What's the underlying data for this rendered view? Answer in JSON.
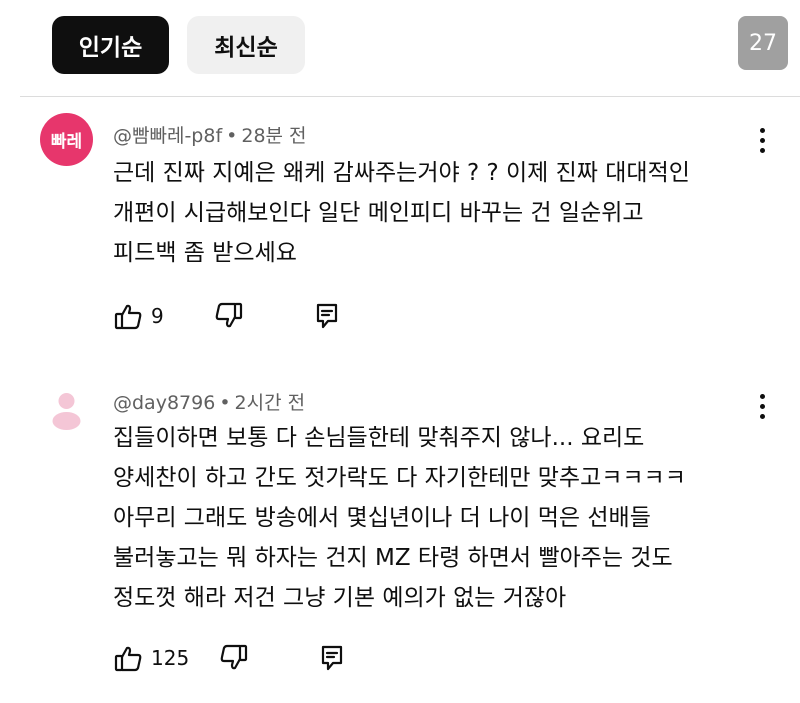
{
  "tabs": {
    "popular": "인기순",
    "latest": "최신순"
  },
  "comment_count": "27",
  "comments": [
    {
      "avatar_text": "빠레",
      "author": "@빰빠레-p8f",
      "separator": "•",
      "time": "28분 전",
      "text": "근데 진짜 지예은 왜케 감싸주는거야 ? ? 이제 진짜 대대적인\n개편이 시급해보인다 일단 메인피디 바꾸는 건 일순위고\n피드백 좀 받으세요",
      "likes": "9"
    },
    {
      "avatar_text": "",
      "author": "@day8796",
      "separator": "•",
      "time": "2시간 전",
      "text": "집들이하면 보통 다 손님들한테 맞춰주지 않나... 요리도\n양세찬이 하고 간도 젓가락도 다 자기한테만 맞추고ㅋㅋㅋㅋ\n아무리 그래도 방송에서 몇십년이나 더 나이 먹은 선배들\n불러놓고는 뭐 하자는 건지 MZ 타령 하면서 빨아주는 것도\n정도껏 해라 저건 그냥 기본 예의가 없는 거잖아",
      "likes": "125"
    }
  ],
  "colors": {
    "avatar_pink": "#e7366c",
    "chip_active": "#0f0f0f",
    "chip_inactive": "#f0f0f0",
    "badge": "#a0a0a0",
    "meta_text": "#606060"
  },
  "icons": {
    "like": "thumbs-up-icon",
    "dislike": "thumbs-down-icon",
    "reply": "reply-icon",
    "more": "more-vertical-icon"
  }
}
